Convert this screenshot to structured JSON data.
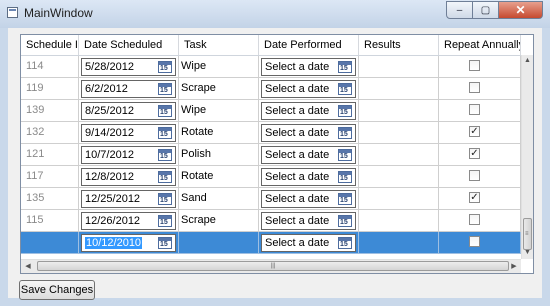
{
  "window": {
    "title": "MainWindow",
    "minimize_glyph": "–",
    "maximize_glyph": "▢",
    "close_glyph": "✕"
  },
  "grid": {
    "columns": [
      "Schedule Id",
      "Date Scheduled",
      "Task",
      "Date Performed",
      "Results",
      "Repeat Annually"
    ],
    "calendar_icon_text": "15",
    "rows": [
      {
        "id": "114",
        "scheduled": "5/28/2012",
        "task": "Wipe",
        "performed": "Select a date",
        "results": "",
        "repeat": false
      },
      {
        "id": "119",
        "scheduled": "6/2/2012",
        "task": "Scrape",
        "performed": "Select a date",
        "results": "",
        "repeat": false
      },
      {
        "id": "139",
        "scheduled": "8/25/2012",
        "task": "Wipe",
        "performed": "Select a date",
        "results": "",
        "repeat": false
      },
      {
        "id": "132",
        "scheduled": "9/14/2012",
        "task": "Rotate",
        "performed": "Select a date",
        "results": "",
        "repeat": true
      },
      {
        "id": "121",
        "scheduled": "10/7/2012",
        "task": "Polish",
        "performed": "Select a date",
        "results": "",
        "repeat": true
      },
      {
        "id": "117",
        "scheduled": "12/8/2012",
        "task": "Rotate",
        "performed": "Select a date",
        "results": "",
        "repeat": false
      },
      {
        "id": "135",
        "scheduled": "12/25/2012",
        "task": "Sand",
        "performed": "Select a date",
        "results": "",
        "repeat": true
      },
      {
        "id": "115",
        "scheduled": "12/26/2012",
        "task": "Scrape",
        "performed": "Select a date",
        "results": "",
        "repeat": false
      },
      {
        "id": "",
        "scheduled": "10/12/2010",
        "task": "",
        "performed": "Select a date",
        "results": "",
        "repeat": false,
        "selected": true
      }
    ]
  },
  "checkmark_glyph": "✓",
  "save_button": {
    "label": "Save Changes"
  },
  "colors": {
    "selection": "#3d8ad6",
    "titlebar": "#c9d8ea",
    "close_button": "#c64a2f"
  }
}
